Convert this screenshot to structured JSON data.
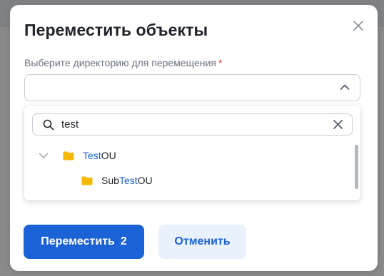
{
  "dialog": {
    "title": "Переместить объекты",
    "field_label": "Выберите директорию для перемещения",
    "required_mark": "*",
    "select_value": ""
  },
  "dropdown": {
    "search_value": "test",
    "tree": [
      {
        "prefix": "",
        "match": "Test",
        "suffix": "OU",
        "expanded": true,
        "icon": "folder-icon"
      },
      {
        "prefix": "Sub",
        "match": "Test",
        "suffix": "OU",
        "icon": "folder-icon"
      }
    ]
  },
  "buttons": {
    "move_label": "Переместить",
    "move_count": "2",
    "cancel_label": "Отменить"
  },
  "colors": {
    "primary": "#1a62d6",
    "required": "#e53935",
    "folder": "#f5b800",
    "secondary_bg": "#e9f1fd"
  }
}
